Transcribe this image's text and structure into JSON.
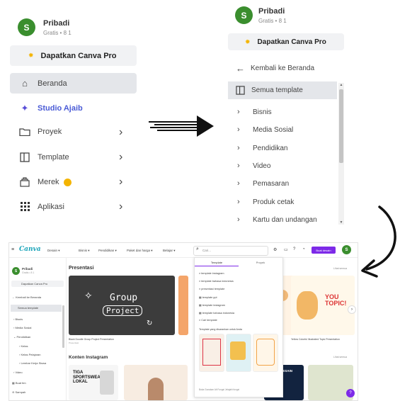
{
  "left_panel": {
    "user_initial": "S",
    "user_name": "Pribadi",
    "user_plan": "Gratis • 8 1",
    "pro_button": "Dapatkan Canva Pro",
    "nav": [
      {
        "label": "Beranda",
        "icon": "home-icon"
      },
      {
        "label": "Studio Ajaib",
        "icon": "sparkle-icon"
      },
      {
        "label": "Proyek",
        "icon": "folder-icon"
      },
      {
        "label": "Template",
        "icon": "template-icon"
      },
      {
        "label": "Merek",
        "icon": "brand-icon"
      },
      {
        "label": "Aplikasi",
        "icon": "apps-grid-icon"
      }
    ]
  },
  "right_panel": {
    "user_initial": "S",
    "user_name": "Pribadi",
    "user_plan": "Gratis • 8 1",
    "pro_button": "Dapatkan Canva Pro",
    "back_label": "Kembali ke Beranda",
    "selected": "Semua template",
    "categories": [
      "Bisnis",
      "Media Sosial",
      "Pendidikan",
      "Video",
      "Pemasaran",
      "Produk cetak",
      "Kartu dan undangan"
    ]
  },
  "screenshot": {
    "logo": "Canva",
    "top_menu": [
      "Desain ▾",
      "Bisnis ▾",
      "Pendidikan ▾",
      "Paket dan harga ▾",
      "Belajar ▾"
    ],
    "search_placeholder": "Cari...",
    "upgrade_button": "Buat desain",
    "avatar_initial": "S",
    "sidebar_user": "Pribadi",
    "sidebar_plan": "Gratis • 8 1",
    "sidebar_pro": "Dapatkan Canva Pro",
    "sidebar_back": "Kembali ke Beranda",
    "sidebar_selected": "Semua template",
    "sidebar_items": [
      "Bisnis",
      "Media Sosial",
      "Pendidikan",
      "Kelas",
      "Kelas Pelajaran",
      "Lembar Kerja Siswa",
      "Video"
    ],
    "sidebar_bottom": [
      "Buat tim",
      "Sampah"
    ],
    "section1_title": "Presentasi",
    "section1_link": "Lihat semua",
    "section2_title": "Konten Instagram",
    "section2_link": "Lihat semua",
    "card_group_1": "Group",
    "card_group_2": "Project",
    "card_caption": "Black Doodle Group Project Presentation",
    "card_sub": "Presentasi",
    "card_right_caption": "Yellow Colorful Illustrated Topic Presentation",
    "topic_text": "YOU TOPIC!",
    "insta_text": "TIGA SPORTSWEAR LOKAL",
    "insta_text2": "TEKNIK DESAIN",
    "dropdown_tabs": [
      "Template",
      "Proyek"
    ],
    "dropdown_items": [
      "template instagram",
      "template bahasa indonesia",
      "presentasi template",
      "template ppt",
      "template instagram",
      "template bahasa indonesia",
      "Cari template"
    ],
    "dropdown_section": "Template yang disarankan untuk Anda",
    "dropdown_footer": "Buka Gunakan Alt Fungsi   Jelajahi fungsi"
  }
}
